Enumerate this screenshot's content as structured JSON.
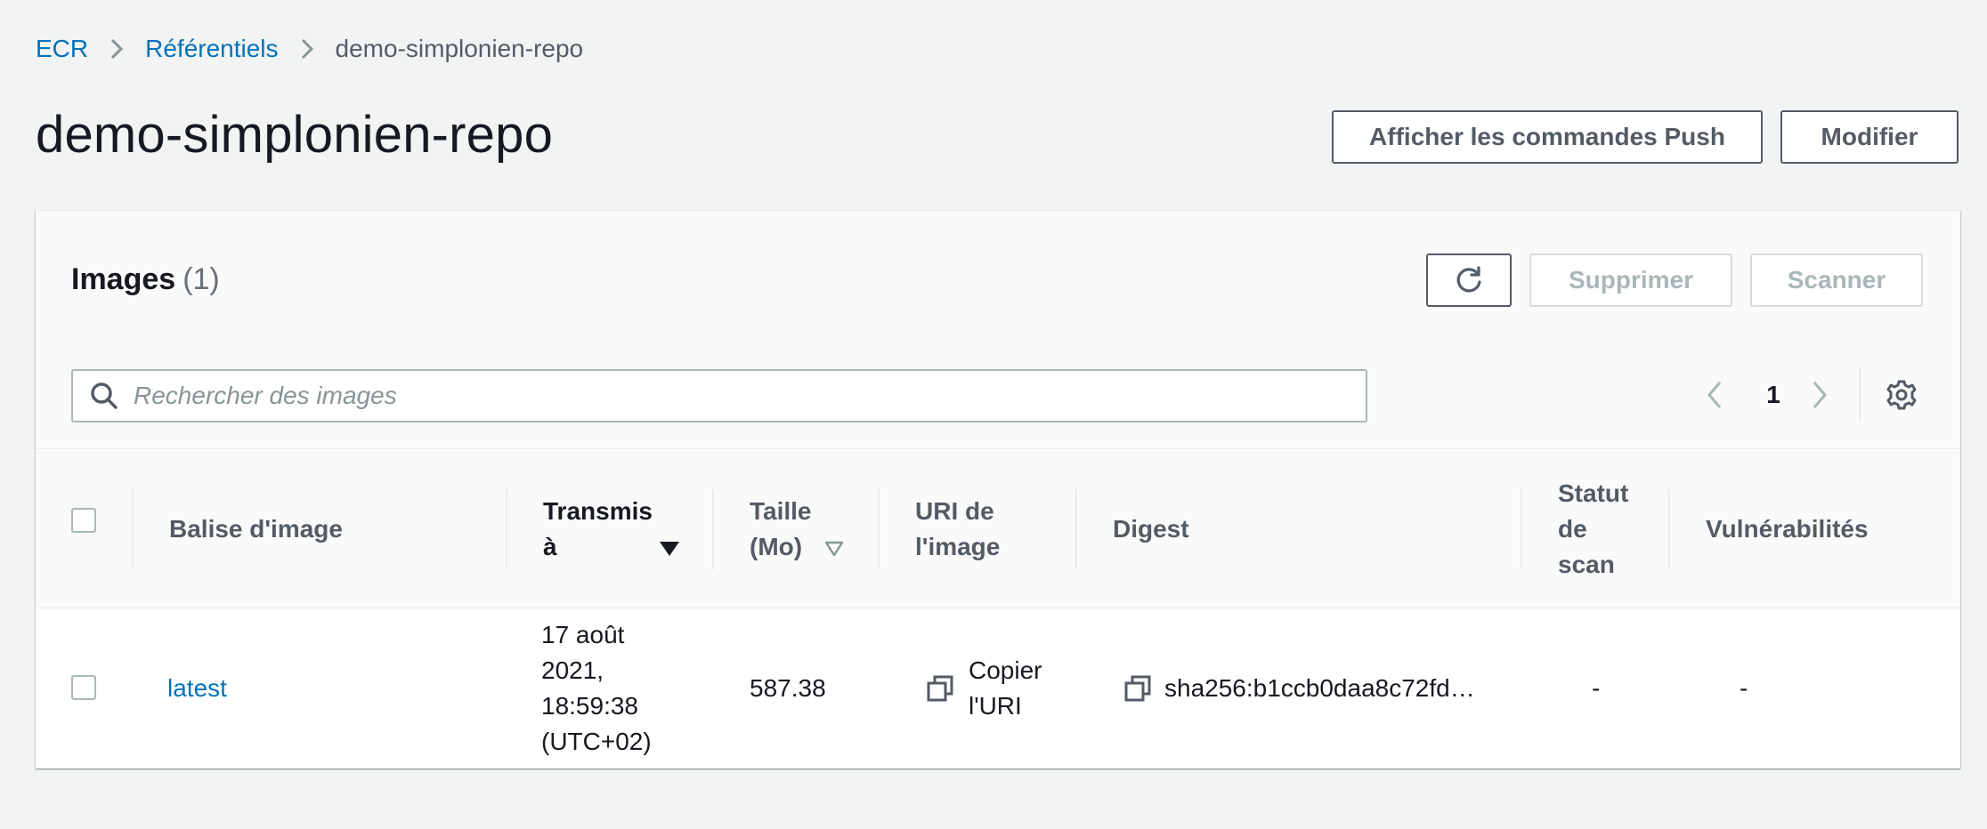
{
  "breadcrumb": {
    "items": [
      "ECR",
      "Référentiels",
      "demo-simplonien-repo"
    ]
  },
  "page": {
    "title": "demo-simplonien-repo",
    "push_commands_label": "Afficher les commandes Push",
    "edit_label": "Modifier"
  },
  "images_panel": {
    "title": "Images",
    "count": "(1)",
    "delete_label": "Supprimer",
    "scan_label": "Scanner",
    "search_placeholder": "Rechercher des images",
    "current_page": "1"
  },
  "table": {
    "columns": {
      "tag": "Balise d'image",
      "pushed_at_line1": "Transmis",
      "pushed_at_line2": "à",
      "size_line1": "Taille",
      "size_line2": "(Mo)",
      "uri_line1": "URI de",
      "uri_line2": "l'image",
      "digest": "Digest",
      "scan_status_line1": "Statut",
      "scan_status_line2": "de",
      "scan_status_line3": "scan",
      "vulnerabilities": "Vulnérabilités"
    },
    "rows": [
      {
        "tag": "latest",
        "pushed_line1": "17 août",
        "pushed_line2": "2021,",
        "pushed_line3": "18:59:38",
        "pushed_line4": "(UTC+02)",
        "size": "587.38",
        "copy_uri_line1": "Copier",
        "copy_uri_line2": "l'URI",
        "digest": "sha256:b1ccb0daa8c72fd…",
        "scan_status": "-",
        "vulnerabilities": "-"
      }
    ]
  },
  "colors": {
    "link": "#0073bb",
    "background": "#f2f3f3",
    "text": "#16191f",
    "muted": "#545b64",
    "disabled": "#aab7b8"
  }
}
